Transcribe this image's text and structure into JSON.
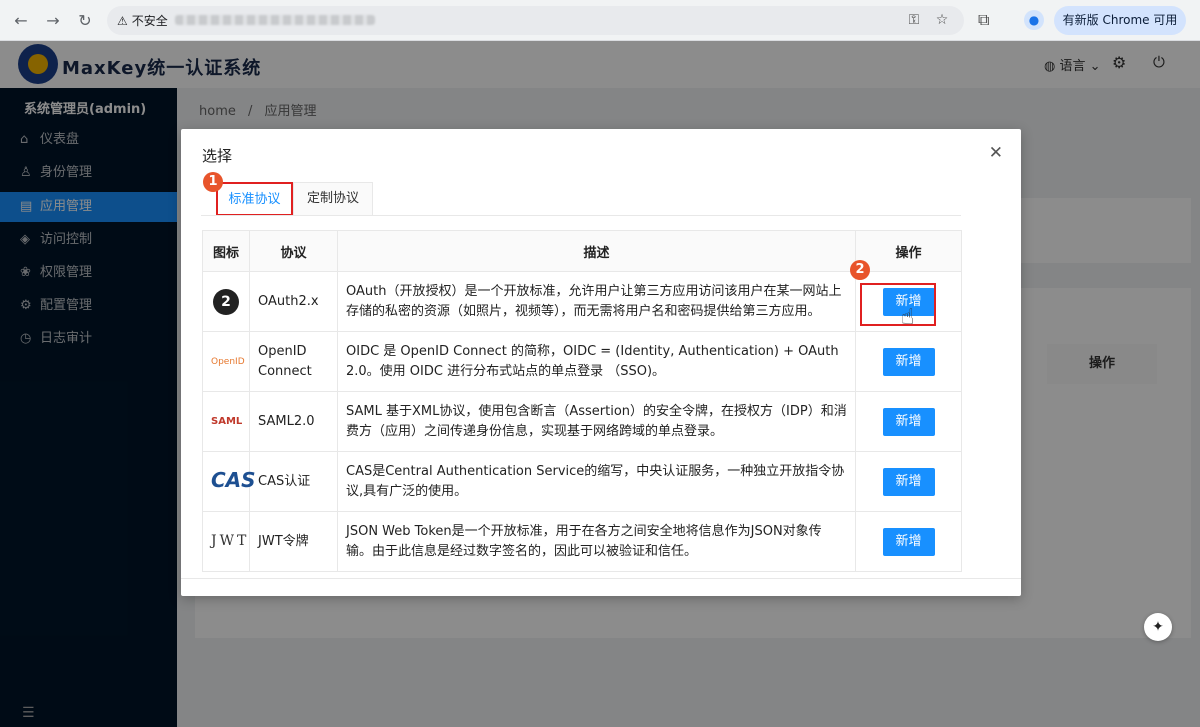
{
  "browser": {
    "insecure_label": "不安全",
    "update_label": "有新版 Chrome 可用"
  },
  "header": {
    "app_title": "MaxKey统一认证系统",
    "language_label": "语言"
  },
  "sidebar": {
    "user": "系统管理员(admin)",
    "items": [
      {
        "label": "仪表盘",
        "icon": "home-icon"
      },
      {
        "label": "身份管理",
        "icon": "user-icon"
      },
      {
        "label": "应用管理",
        "icon": "app-icon",
        "active": true
      },
      {
        "label": "访问控制",
        "icon": "shield-icon"
      },
      {
        "label": "权限管理",
        "icon": "permission-icon"
      },
      {
        "label": "配置管理",
        "icon": "settings-icon"
      },
      {
        "label": "日志审计",
        "icon": "log-icon"
      }
    ]
  },
  "breadcrumb": {
    "home": "home",
    "sep": "/",
    "current": "应用管理"
  },
  "background": {
    "op_header": "操作"
  },
  "modal": {
    "title": "选择",
    "tabs": [
      "标准协议",
      "定制协议"
    ],
    "badge1": "1",
    "badge2": "2",
    "columns": [
      "图标",
      "协议",
      "描述",
      "操作"
    ],
    "rows": [
      {
        "icon": "oauth2-icon",
        "icon_text": "2",
        "protocol": "OAuth2.x",
        "desc": "OAuth（开放授权）是一个开放标准，允许用户让第三方应用访问该用户在某一网站上存储的私密的资源（如照片，视频等），而无需将用户名和密码提供给第三方应用。",
        "action": "新增"
      },
      {
        "icon": "openid-icon",
        "icon_text": "OpenID",
        "protocol": "OpenID Connect",
        "desc": "OIDC 是 OpenID Connect 的简称，OIDC = (Identity, Authentication) + OAuth 2.0。使用 OIDC 进行分布式站点的单点登录 （SSO)。",
        "action": "新增"
      },
      {
        "icon": "saml-icon",
        "icon_text": "SAML",
        "protocol": "SAML2.0",
        "desc": "SAML 基于XML协议，使用包含断言（Assertion）的安全令牌，在授权方（IDP）和消费方（应用）之间传递身份信息，实现基于网络跨域的单点登录。",
        "action": "新增"
      },
      {
        "icon": "cas-icon",
        "icon_text": "CAS",
        "protocol": "CAS认证",
        "desc": "CAS是Central Authentication Service的缩写，中央认证服务，一种独立开放指令协议,具有广泛的使用。",
        "action": "新增"
      },
      {
        "icon": "jwt-icon",
        "icon_text": "JWT",
        "protocol": "JWT令牌",
        "desc": "JSON Web Token是一个开放标准，用于在各方之间安全地将信息作为JSON对象传输。由于此信息是经过数字签名的，因此可以被验证和信任。",
        "action": "新增"
      }
    ]
  }
}
